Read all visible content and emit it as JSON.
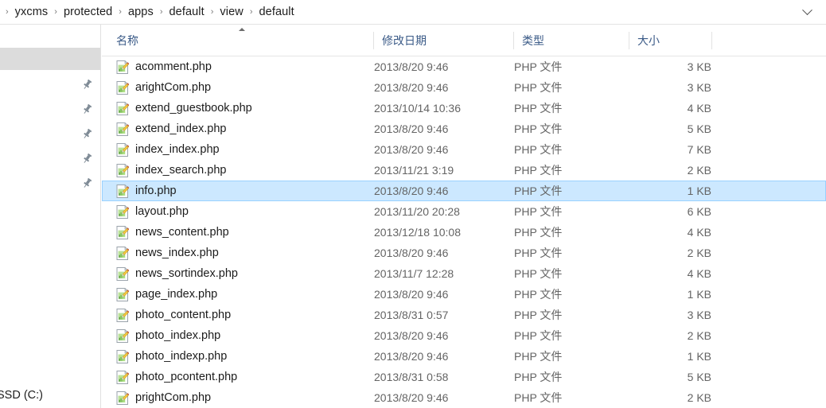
{
  "window": {
    "type": "file-explorer",
    "accent_selected_bg": "#cce8ff",
    "accent_selected_border": "#99d1ff",
    "header_text_color": "#3a5a87"
  },
  "addressbar": {
    "leading_separator": "›",
    "separator": "›",
    "crumbs": [
      {
        "label": "yxcms"
      },
      {
        "label": "protected"
      },
      {
        "label": "apps"
      },
      {
        "label": "default"
      },
      {
        "label": "view"
      },
      {
        "label": "default"
      }
    ],
    "dropdown_icon": "chevron-down-icon"
  },
  "navpane": {
    "pin_icon": "pushpin-icon",
    "pins": [
      {},
      {},
      {},
      {},
      {}
    ],
    "bottom_item_label": "SSD (C:)"
  },
  "columns": {
    "name": "名称",
    "date_modified": "修改日期",
    "type": "类型",
    "size": "大小",
    "sort_indicator": "ascending"
  },
  "files": [
    {
      "name": "acomment.php",
      "date": "2013/8/20 9:46",
      "type": "PHP 文件",
      "size": "3 KB",
      "icon": "php-file-icon",
      "selected": false
    },
    {
      "name": "arightCom.php",
      "date": "2013/8/20 9:46",
      "type": "PHP 文件",
      "size": "3 KB",
      "icon": "php-file-icon",
      "selected": false
    },
    {
      "name": "extend_guestbook.php",
      "date": "2013/10/14 10:36",
      "type": "PHP 文件",
      "size": "4 KB",
      "icon": "php-file-icon",
      "selected": false
    },
    {
      "name": "extend_index.php",
      "date": "2013/8/20 9:46",
      "type": "PHP 文件",
      "size": "5 KB",
      "icon": "php-file-icon",
      "selected": false
    },
    {
      "name": "index_index.php",
      "date": "2013/8/20 9:46",
      "type": "PHP 文件",
      "size": "7 KB",
      "icon": "php-file-icon",
      "selected": false
    },
    {
      "name": "index_search.php",
      "date": "2013/11/21 3:19",
      "type": "PHP 文件",
      "size": "2 KB",
      "icon": "php-file-icon",
      "selected": false
    },
    {
      "name": "info.php",
      "date": "2013/8/20 9:46",
      "type": "PHP 文件",
      "size": "1 KB",
      "icon": "php-file-icon",
      "selected": true
    },
    {
      "name": "layout.php",
      "date": "2013/11/20 20:28",
      "type": "PHP 文件",
      "size": "6 KB",
      "icon": "php-file-icon",
      "selected": false
    },
    {
      "name": "news_content.php",
      "date": "2013/12/18 10:08",
      "type": "PHP 文件",
      "size": "4 KB",
      "icon": "php-file-icon",
      "selected": false
    },
    {
      "name": "news_index.php",
      "date": "2013/8/20 9:46",
      "type": "PHP 文件",
      "size": "2 KB",
      "icon": "php-file-icon",
      "selected": false
    },
    {
      "name": "news_sortindex.php",
      "date": "2013/11/7 12:28",
      "type": "PHP 文件",
      "size": "4 KB",
      "icon": "php-file-icon",
      "selected": false
    },
    {
      "name": "page_index.php",
      "date": "2013/8/20 9:46",
      "type": "PHP 文件",
      "size": "1 KB",
      "icon": "php-file-icon",
      "selected": false
    },
    {
      "name": "photo_content.php",
      "date": "2013/8/31 0:57",
      "type": "PHP 文件",
      "size": "3 KB",
      "icon": "php-file-icon",
      "selected": false
    },
    {
      "name": "photo_index.php",
      "date": "2013/8/20 9:46",
      "type": "PHP 文件",
      "size": "2 KB",
      "icon": "php-file-icon",
      "selected": false
    },
    {
      "name": "photo_indexp.php",
      "date": "2013/8/20 9:46",
      "type": "PHP 文件",
      "size": "1 KB",
      "icon": "php-file-icon",
      "selected": false
    },
    {
      "name": "photo_pcontent.php",
      "date": "2013/8/31 0:58",
      "type": "PHP 文件",
      "size": "5 KB",
      "icon": "php-file-icon",
      "selected": false
    },
    {
      "name": "prightCom.php",
      "date": "2013/8/20 9:46",
      "type": "PHP 文件",
      "size": "2 KB",
      "icon": "php-file-icon",
      "selected": false
    }
  ]
}
